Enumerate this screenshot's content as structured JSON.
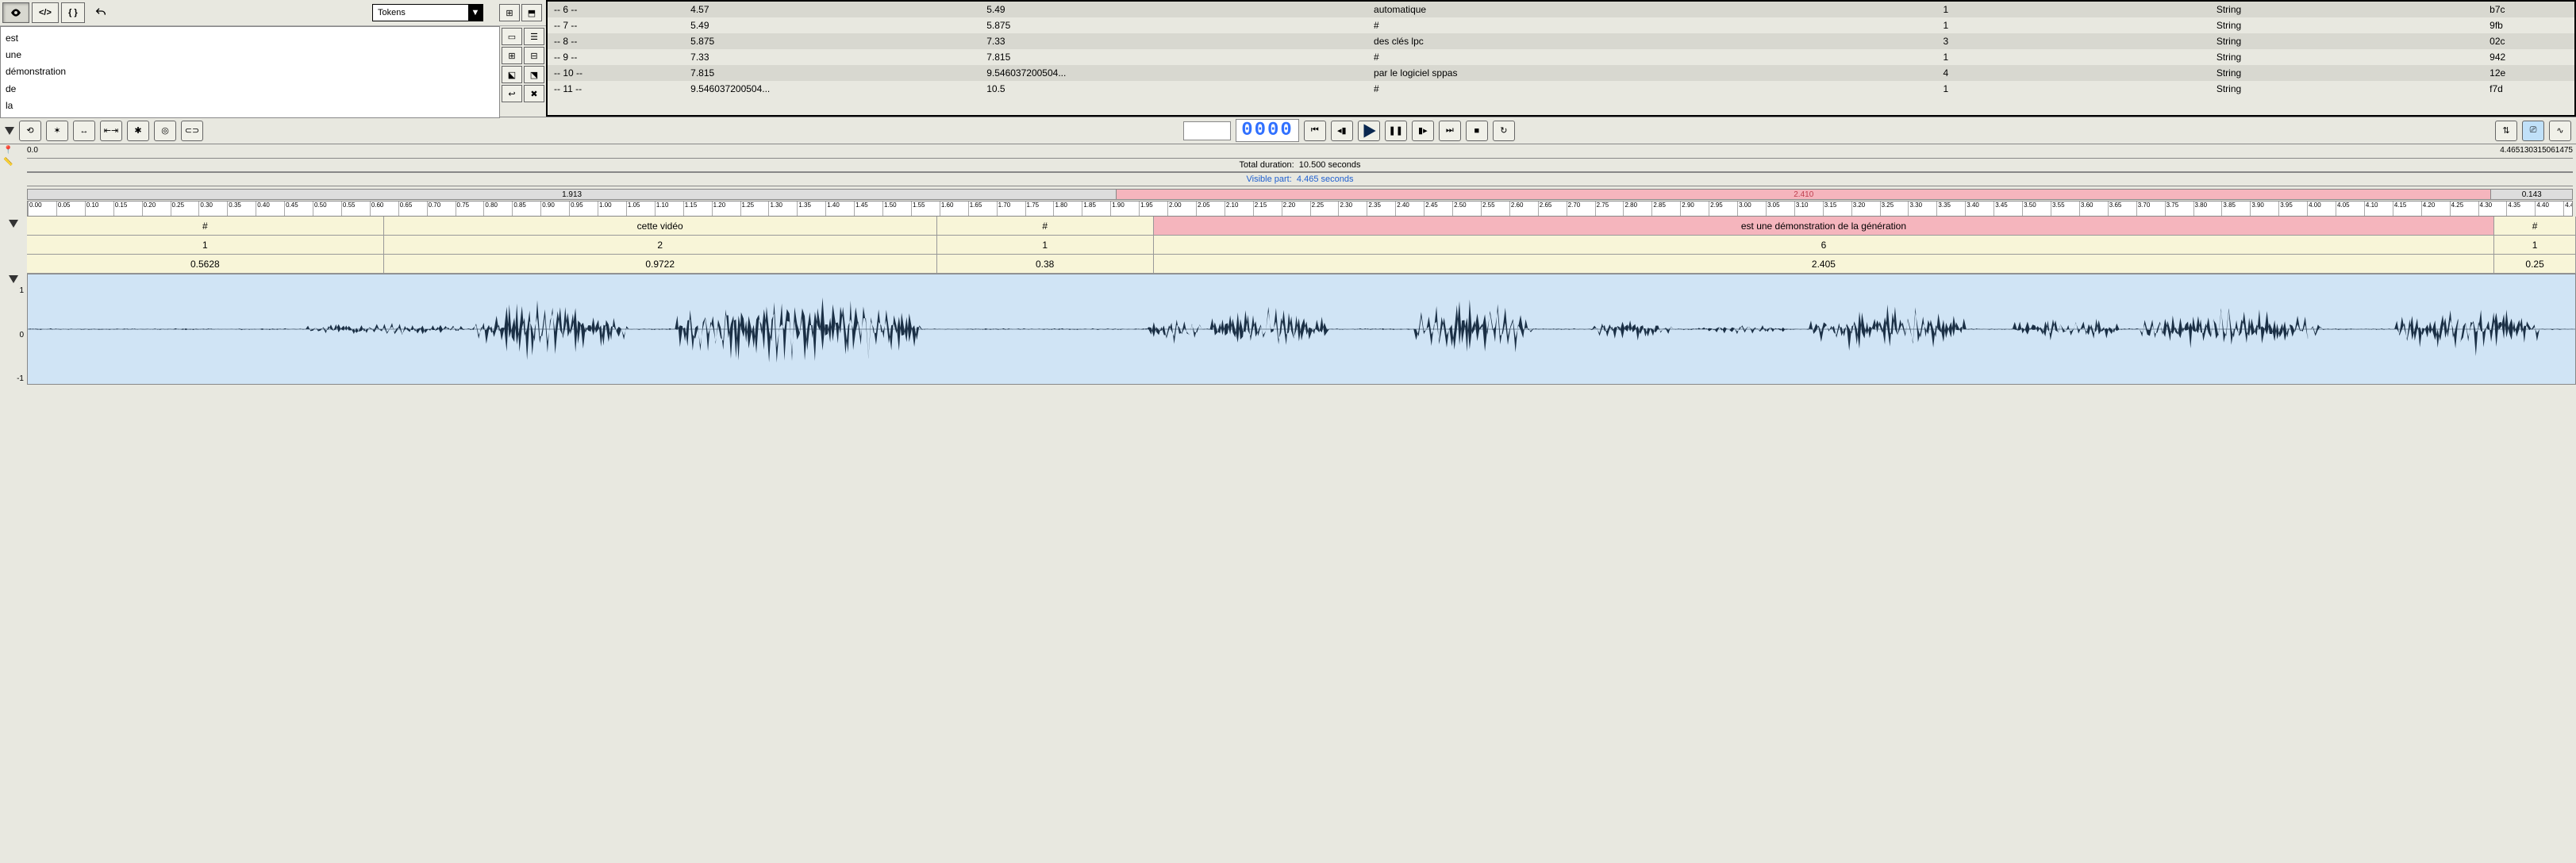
{
  "dropdown": {
    "selected": "Tokens"
  },
  "text_list": [
    "est",
    "une",
    "démonstration",
    "de",
    "la"
  ],
  "table_rows": [
    {
      "idx": "-- 6 --",
      "start": "4.57",
      "end": "5.49",
      "label": "automatique",
      "n": "1",
      "type": "String",
      "hash": "b7c"
    },
    {
      "idx": "-- 7 --",
      "start": "5.49",
      "end": "5.875",
      "label": "#",
      "n": "1",
      "type": "String",
      "hash": "9fb"
    },
    {
      "idx": "-- 8 --",
      "start": "5.875",
      "end": "7.33",
      "label": "des clés lpc",
      "n": "3",
      "type": "String",
      "hash": "02c"
    },
    {
      "idx": "-- 9 --",
      "start": "7.33",
      "end": "7.815",
      "label": "#",
      "n": "1",
      "type": "String",
      "hash": "942"
    },
    {
      "idx": "-- 10 --",
      "start": "7.815",
      "end": "9.546037200504...",
      "label": "par le logiciel sppas",
      "n": "4",
      "type": "String",
      "hash": "12e"
    },
    {
      "idx": "-- 11 --",
      "start": "9.546037200504...",
      "end": "10.5",
      "label": "#",
      "n": "1",
      "type": "String",
      "hash": "f7d"
    }
  ],
  "seg_display": "0000",
  "timeline": {
    "pos_start": "0.0",
    "pos_end": "4.465130315061475",
    "total_duration_label": "Total duration:",
    "total_duration_value": "10.500 seconds",
    "visible_label": "Visible part:",
    "visible_value": "4.465 seconds",
    "overview_left": "1.913",
    "overview_mid": "2.410",
    "overview_right": "0.143"
  },
  "tiers": {
    "row1": [
      {
        "text": "#",
        "w": 14.0,
        "cls": ""
      },
      {
        "text": "cette vidéo",
        "w": 21.7,
        "cls": ""
      },
      {
        "text": "#",
        "w": 8.5,
        "cls": ""
      },
      {
        "text": "est une démonstration de la génération",
        "w": 52.6,
        "cls": "pink"
      },
      {
        "text": "#",
        "w": 3.2,
        "cls": ""
      }
    ],
    "row2": [
      {
        "text": "1",
        "w": 14.0
      },
      {
        "text": "2",
        "w": 21.7
      },
      {
        "text": "1",
        "w": 8.5
      },
      {
        "text": "6",
        "w": 52.6
      },
      {
        "text": "1",
        "w": 3.2
      }
    ],
    "row3": [
      {
        "text": "0.5628",
        "w": 14.0
      },
      {
        "text": "0.9722",
        "w": 21.7
      },
      {
        "text": "0.38",
        "w": 8.5
      },
      {
        "text": "2.405",
        "w": 52.6
      },
      {
        "text": "0.25",
        "w": 3.2
      }
    ]
  },
  "wave_labels": {
    "top": "1",
    "mid": "0",
    "bot": "-1"
  }
}
